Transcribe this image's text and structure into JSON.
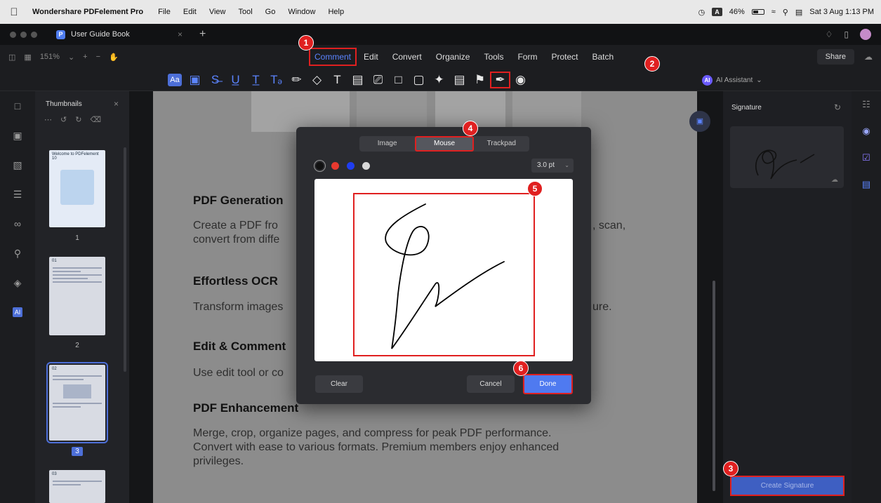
{
  "menubar": {
    "app": "Wondershare PDFelement Pro",
    "items": [
      "File",
      "Edit",
      "View",
      "Tool",
      "Go",
      "Window",
      "Help"
    ],
    "input_indicator": "A",
    "battery": "46%",
    "datetime": "Sat 3 Aug 1:13 PM"
  },
  "tab": {
    "title": "User Guide Book",
    "icon_letter": "P"
  },
  "zoom": {
    "value": "151%"
  },
  "top_menu": [
    "Comment",
    "Edit",
    "Convert",
    "Organize",
    "Tools",
    "Form",
    "Protect",
    "Batch"
  ],
  "share_label": "Share",
  "tool_icons": [
    "text-box-icon",
    "area-icon",
    "strikethrough-icon",
    "underline-icon",
    "insert-text-icon",
    "replace-text-icon",
    "highlight-icon",
    "eraser-icon",
    "text-icon",
    "textbox-icon",
    "callout-icon",
    "note-icon",
    "shape-icon",
    "pin-icon",
    "measure-icon",
    "stamp-icon",
    "signature-icon",
    "eye-icon"
  ],
  "tool_aa": "Aa",
  "ai_assistant": {
    "badge": "AI",
    "label": "AI Assistant"
  },
  "rail_ai": "AI",
  "thumbnails": {
    "title": "Thumbnails",
    "pages": [
      {
        "num": "1",
        "title": "Welcome to PDFelement 10"
      },
      {
        "num": "2",
        "title": "01"
      },
      {
        "num": "3",
        "title": "02"
      },
      {
        "num": "",
        "title": "03"
      }
    ]
  },
  "document": {
    "sections": [
      {
        "heading": "PDF Generation",
        "body": [
          "Create a PDF fro",
          "convert from diffe"
        ],
        "tail": ", scan,"
      },
      {
        "heading": "Effortless OCR",
        "body": [
          "Transform images"
        ],
        "tail": "ure."
      },
      {
        "heading": "Edit & Comment",
        "body": [
          "Use edit tool or co"
        ],
        "tail": ""
      },
      {
        "heading": "PDF Enhancement",
        "body": [
          "Merge, crop, organize pages, and compress for peak PDF performance.",
          "Convert with ease to various formats. Premium members enjoy enhanced",
          "privileges."
        ],
        "tail": ""
      }
    ]
  },
  "signature_panel": {
    "title": "Signature",
    "create_label": "Create Signature"
  },
  "dialog": {
    "tabs": [
      "Image",
      "Mouse",
      "Trackpad"
    ],
    "active_tab": "Mouse",
    "colors": [
      "#111111",
      "#e8392f",
      "#1f3df0",
      "#d8d8d8"
    ],
    "pen_size": "3.0 pt",
    "clear_label": "Clear",
    "cancel_label": "Cancel",
    "done_label": "Done"
  },
  "steps": [
    "1",
    "2",
    "3",
    "4",
    "5",
    "6"
  ]
}
